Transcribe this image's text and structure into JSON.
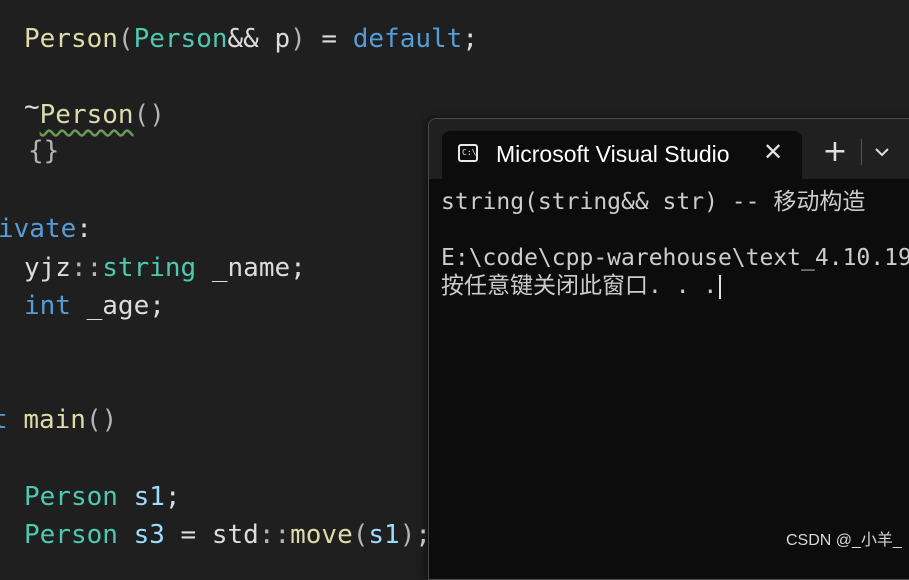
{
  "editor": {
    "lines": [
      {
        "id": "l1",
        "tokens": [
          {
            "cls": "t-fn",
            "text": "Person"
          },
          {
            "cls": "t-punc",
            "text": "("
          },
          {
            "cls": "t-class",
            "text": "Person"
          },
          {
            "cls": "t-plain",
            "text": "&& p"
          },
          {
            "cls": "t-punc",
            "text": ")"
          },
          {
            "cls": "t-plain",
            "text": " = "
          },
          {
            "cls": "t-kw",
            "text": "default"
          },
          {
            "cls": "t-plain",
            "text": ";"
          }
        ]
      },
      {
        "id": "l2",
        "tokens": [
          {
            "cls": "tilde",
            "text": "~"
          },
          {
            "cls": "t-squiggle",
            "text": "Person"
          },
          {
            "cls": "t-punc",
            "text": "()"
          }
        ]
      },
      {
        "id": "l3",
        "tokens": [
          {
            "cls": "t-punc",
            "text": "{}"
          }
        ]
      },
      {
        "id": "l4",
        "tokens": [
          {
            "cls": "t-kw",
            "text": "ivate"
          },
          {
            "cls": "t-plain",
            "text": ":"
          }
        ]
      },
      {
        "id": "l5",
        "tokens": [
          {
            "cls": "t-plain",
            "text": "yjz"
          },
          {
            "cls": "t-punc",
            "text": "::"
          },
          {
            "cls": "t-class",
            "text": "string"
          },
          {
            "cls": "t-plain",
            "text": " _name;"
          }
        ]
      },
      {
        "id": "l6",
        "tokens": [
          {
            "cls": "t-kw",
            "text": "int"
          },
          {
            "cls": "t-plain",
            "text": " _age;"
          }
        ]
      },
      {
        "id": "l7",
        "tokens": [
          {
            "cls": "t-kw",
            "text": "t"
          },
          {
            "cls": "t-plain",
            "text": " "
          },
          {
            "cls": "t-fn",
            "text": "main"
          },
          {
            "cls": "t-punc",
            "text": "()"
          }
        ]
      },
      {
        "id": "l8",
        "tokens": [
          {
            "cls": "t-class",
            "text": "Person"
          },
          {
            "cls": "t-plain",
            "text": " "
          },
          {
            "cls": "t-var",
            "text": "s1"
          },
          {
            "cls": "t-plain",
            "text": ";"
          }
        ]
      },
      {
        "id": "l9",
        "tokens": [
          {
            "cls": "t-class",
            "text": "Person"
          },
          {
            "cls": "t-plain",
            "text": " "
          },
          {
            "cls": "t-var",
            "text": "s3"
          },
          {
            "cls": "t-plain",
            "text": " = std"
          },
          {
            "cls": "t-punc",
            "text": "::"
          },
          {
            "cls": "t-fn",
            "text": "move"
          },
          {
            "cls": "t-punc",
            "text": "("
          },
          {
            "cls": "t-var",
            "text": "s1"
          },
          {
            "cls": "t-punc",
            "text": ")"
          },
          {
            "cls": "t-plain",
            "text": ";"
          }
        ]
      }
    ]
  },
  "terminal": {
    "tab_title": "Microsoft Visual Studio",
    "icon_text": "C:\\",
    "close_glyph": "✕",
    "new_tab_glyph": "+",
    "output": [
      "string(string&& str) -- 移动构造",
      "",
      "E:\\code\\cpp-warehouse\\text_4.10.19",
      "按任意键关闭此窗口. . ."
    ]
  },
  "watermark": "CSDN @_小羊_",
  "colors": {
    "editor_bg": "#1f1f1f",
    "terminal_bg": "#0c0c0c",
    "type": "#4ec9b0",
    "keyword": "#569cd6",
    "function": "#dcdcaa",
    "variable": "#9cdcfe"
  }
}
